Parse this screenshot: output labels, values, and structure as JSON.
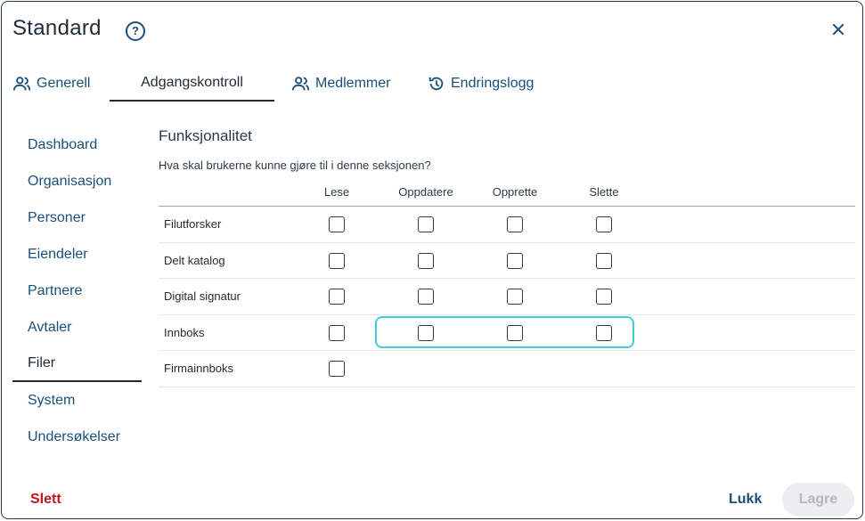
{
  "dialog": {
    "title": "Standard",
    "help_icon": "help-circle-icon",
    "close_icon": "close-icon"
  },
  "tabs": [
    {
      "label": "Generell",
      "icon": "people-icon",
      "active": false
    },
    {
      "label": "Adgangskontroll",
      "icon": null,
      "active": true
    },
    {
      "label": "Medlemmer",
      "icon": "people-icon",
      "active": false
    },
    {
      "label": "Endringslogg",
      "icon": "history-icon",
      "active": false
    }
  ],
  "sidebar": {
    "items": [
      {
        "label": "Dashboard"
      },
      {
        "label": "Organisasjon"
      },
      {
        "label": "Personer"
      },
      {
        "label": "Eiendeler"
      },
      {
        "label": "Partnere"
      },
      {
        "label": "Avtaler"
      },
      {
        "label": "Filer",
        "active": true
      },
      {
        "label": "System"
      },
      {
        "label": "Undersøkelser"
      }
    ]
  },
  "section": {
    "title": "Funksjonalitet",
    "question": "Hva skal brukerne kunne gjøre til i denne seksjonen?"
  },
  "permissions": {
    "columns": [
      "Lese",
      "Oppdatere",
      "Opprette",
      "Slette"
    ],
    "rows": [
      {
        "label": "Filutforsker",
        "checks": [
          false,
          false,
          false,
          false
        ]
      },
      {
        "label": "Delt katalog",
        "checks": [
          false,
          false,
          false,
          false
        ]
      },
      {
        "label": "Digital signatur",
        "checks": [
          false,
          false,
          false,
          false
        ]
      },
      {
        "label": "Innboks",
        "checks": [
          false,
          false,
          false,
          false
        ]
      },
      {
        "label": "Firmainnboks",
        "checks": [
          false
        ]
      }
    ]
  },
  "footer": {
    "delete_label": "Slett",
    "close_label": "Lukk",
    "save_label": "Lagre"
  },
  "colors": {
    "accent": "#1b4f7a",
    "danger": "#c0141b",
    "focus": "#3fcfdc"
  }
}
